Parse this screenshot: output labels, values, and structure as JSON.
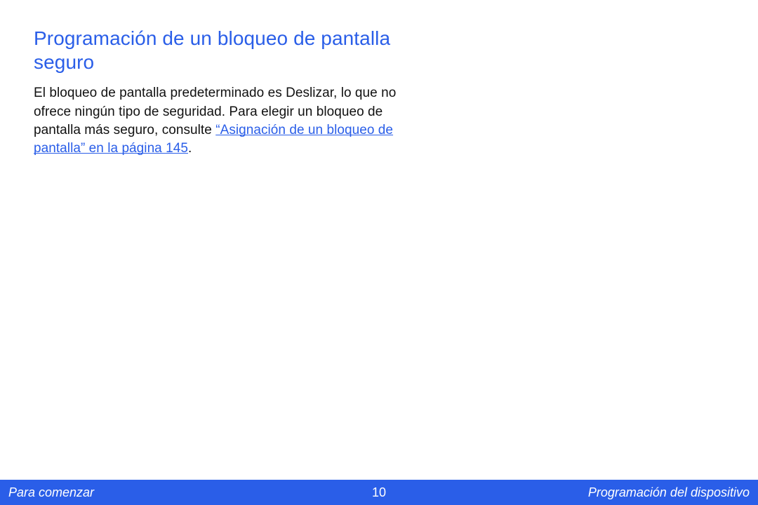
{
  "main": {
    "heading": "Programación de un bloqueo de pantalla seguro",
    "body_before_link": "El bloqueo de pantalla predeterminado es Deslizar, lo que no ofrece ningún tipo de seguridad. Para elegir un bloqueo de pantalla más seguro, consulte ",
    "link_text": "“Asignación de un bloqueo de pantalla” en la página 145",
    "body_after_link": "."
  },
  "footer": {
    "left": "Para comenzar",
    "page_number": "10",
    "right": "Programación del dispositivo"
  }
}
